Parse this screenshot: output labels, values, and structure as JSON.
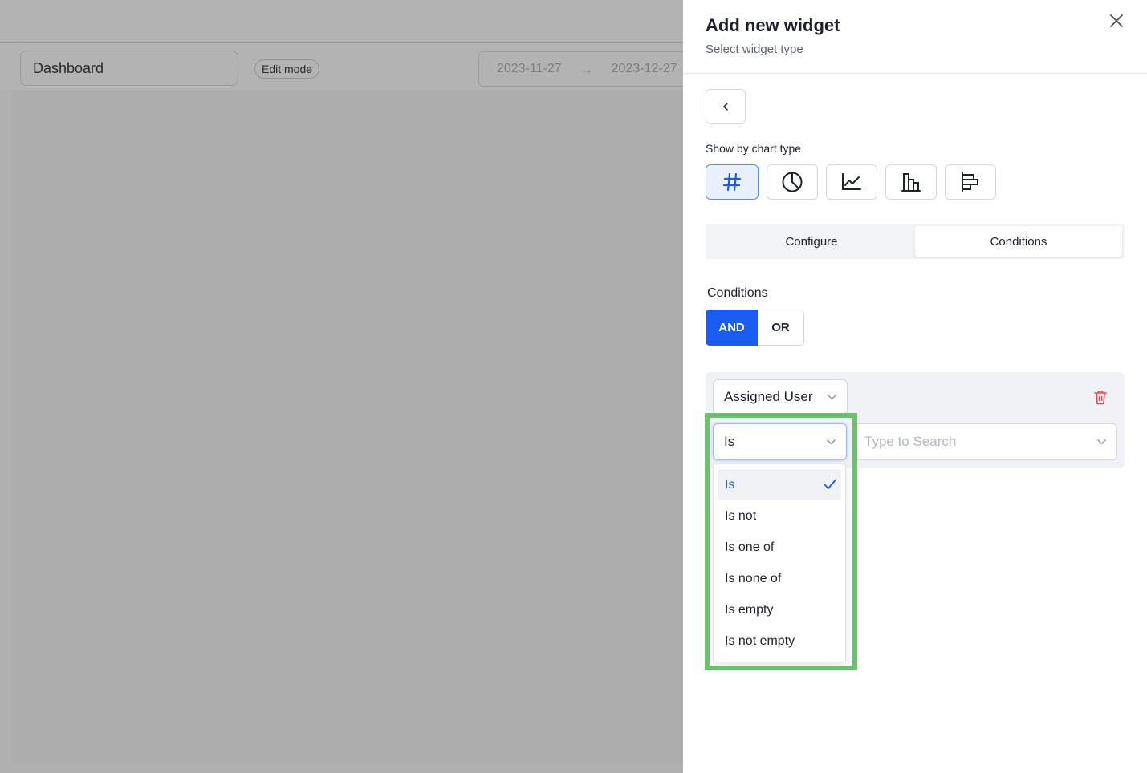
{
  "background": {
    "dashboard_name": "Dashboard",
    "edit_badge": "Edit mode",
    "date_from": "2023-11-27",
    "date_to": "2023-12-27"
  },
  "drawer": {
    "title": "Add new widget",
    "subtitle": "Select widget type",
    "chart_type_label": "Show by chart type",
    "chart_types": [
      {
        "icon": "hash-icon",
        "active": true
      },
      {
        "icon": "pie-chart-icon",
        "active": false
      },
      {
        "icon": "line-chart-icon",
        "active": false
      },
      {
        "icon": "bar-chart-icon",
        "active": false
      },
      {
        "icon": "horizontal-bar-chart-icon",
        "active": false
      }
    ],
    "tabs": [
      {
        "label": "Configure",
        "active": false
      },
      {
        "label": "Conditions",
        "active": true
      }
    ]
  },
  "conditions": {
    "label": "Conditions",
    "logic": {
      "and_label": "AND",
      "or_label": "OR",
      "selected": "AND"
    },
    "field_value": "Assigned User",
    "operator_value": "Is",
    "value_placeholder": "Type to Search",
    "operator_options": [
      "Is",
      "Is not",
      "Is one of",
      "Is none of",
      "Is empty",
      "Is not empty"
    ],
    "selected_operator": "Is"
  },
  "colors": {
    "accent": "#1a5cf0",
    "highlight": "#6cc070",
    "delete": "#e5484d"
  }
}
